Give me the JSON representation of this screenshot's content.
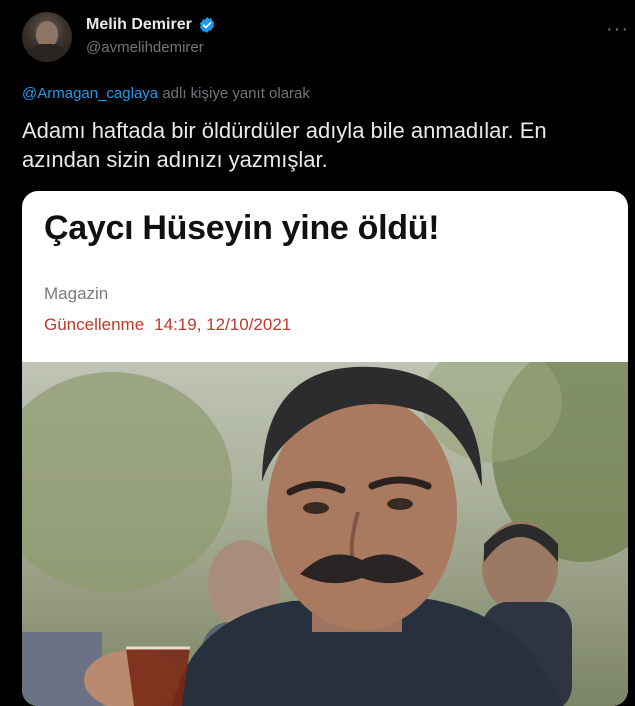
{
  "tweet": {
    "display_name": "Melih Demirer",
    "handle": "@avmelihdemirer",
    "reply_to": "@Armagan_caglaya",
    "reply_suffix": "adlı kişiye yanıt olarak",
    "text": "Adamı haftada bir öldürdüler adıyla bile anmadılar. En azından sizin adınızı yazmışlar.",
    "more_icon": "more-icon",
    "verified_color": "#1d9bf0"
  },
  "card": {
    "title": "Çaycı Hüseyin yine öldü!",
    "category": "Magazin",
    "updated_label": "Güncellenme",
    "updated_time": "14:19, 12/10/2021",
    "accent_color": "#c0392b"
  }
}
